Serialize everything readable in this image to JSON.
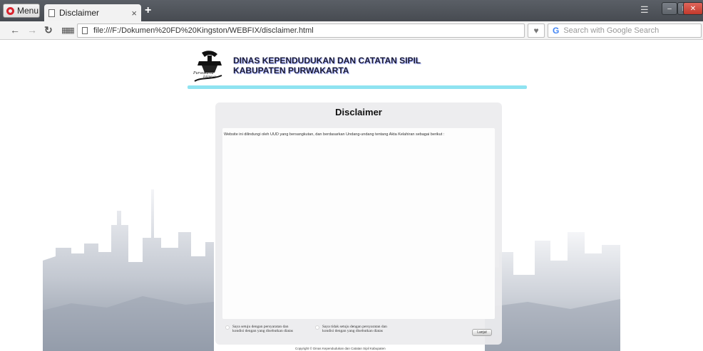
{
  "browser": {
    "menu_label": "Menu",
    "tab_title": "Disclaimer",
    "tab_close": "×",
    "new_tab": "+",
    "url": "file:///F:/Dokumen%20FD%20Kingston/WEBFIX/disclaimer.html",
    "search_placeholder": "Search with Google Search",
    "search_engine_glyph": "G"
  },
  "header": {
    "org_line1": "DINAS KEPENDUDUKAN DAN CATATAN SIPIL",
    "org_line2": "KABUPATEN PURWAKARTA",
    "logo_caption": "Purwakarta",
    "logo_subcaption": "Istimewa"
  },
  "disclaimer": {
    "title": "Disclaimer",
    "body": "Website ini dilindungi oleh UUD yang bersangkutan, dan berdasarkan Undang-undang tentang Akta Kelahiran sebagai berikut :",
    "option_agree": "Saya setuju dengan persyaratan dan kondisi dengan yang disebutkan diatas",
    "option_disagree": "Saya tidak setuju dengan persyaratan dan kondisi dengan yang disebutkan diatas",
    "continue_label": "Lanjut",
    "copyright": "Copyright © Dinas Kependudukan dan Catatan Sipil Kabupaten"
  },
  "colors": {
    "accent_rule": "#8fe3f1",
    "titlebar": "#4d5157",
    "close_button": "#c2392b"
  }
}
